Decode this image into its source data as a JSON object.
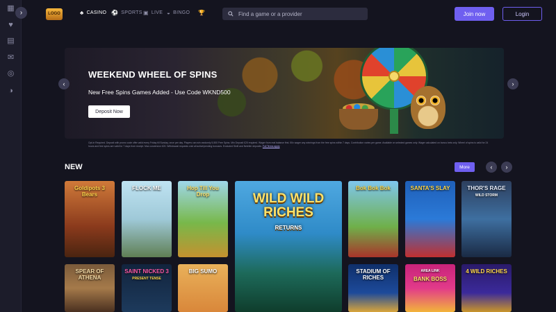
{
  "sidebar": {
    "items": [
      {
        "icon": "grid-icon",
        "glyph": "▦"
      },
      {
        "icon": "heart-icon",
        "glyph": "♥"
      },
      {
        "icon": "document-icon",
        "glyph": "▤"
      },
      {
        "icon": "gift-icon",
        "glyph": "✉"
      },
      {
        "icon": "chip-icon",
        "glyph": "◎"
      },
      {
        "icon": "chat-icon",
        "glyph": "◑"
      }
    ],
    "expand_glyph": "›"
  },
  "header": {
    "logo_text": "LOGO",
    "nav": [
      {
        "label": "CASINO",
        "glyph": "♣",
        "icon": "club-icon",
        "active": true
      },
      {
        "label": "SPORTS",
        "glyph": "⚽",
        "icon": "ball-icon",
        "active": false
      },
      {
        "label": "LIVE",
        "glyph": "▣",
        "icon": "live-icon",
        "active": false
      },
      {
        "label": "BINGO",
        "glyph": "◒",
        "icon": "bingo-icon",
        "active": false
      },
      {
        "label": "",
        "glyph": "🏆",
        "icon": "trophy-icon",
        "active": false
      }
    ],
    "search": {
      "placeholder": "Find a game or a provider",
      "value": ""
    },
    "join_label": "Join now",
    "login_label": "Login",
    "accent_color": "#6f5ff0"
  },
  "banner": {
    "title": "WEEKEND WHEEL OF SPINS",
    "subtitle": "New Free Spins Games Added - Use Code WKND500",
    "cta_label": "Deposit Now",
    "prev_glyph": "‹",
    "next_glyph": "›"
  },
  "terms": {
    "text": "Opt-in Required. Deposit with promo code offer valid every Friday till Sunday, once per day. Players can win randomly 5-500 Free Spins. Min Deposit £20 required. Wager from real balance first. 50x wager any winnings from the free spins within 7 days. Contribution varies per game. Available on selected games only. Wager calculated on bonus bets only. Wheel of spins is valid for 24 hours and free spins are valid for 7 days from receipt. Max conversion £20. Withdrawal requests void all active/pending bonuses. Excluded Skrill and Neteller deposits.",
    "link_label": "Full Terms apply"
  },
  "new_section": {
    "title": "NEW",
    "more_label": "More",
    "prev_glyph": "‹",
    "next_glyph": "›",
    "games": [
      {
        "name": "Goldipots 3 Bears",
        "sub": ""
      },
      {
        "name": "FLOCK ME",
        "sub": ""
      },
      {
        "name": "Hop Till You Drop",
        "sub": ""
      },
      {
        "name": "WILD WILD RICHES",
        "sub": "RETURNS"
      },
      {
        "name": "Bok Bok Bok",
        "sub": ""
      },
      {
        "name": "SANTA'S SLAY",
        "sub": ""
      },
      {
        "name": "THOR'S RAGE",
        "sub": "WILD STORM"
      },
      {
        "name": "SPEAR OF ATHENA",
        "sub": ""
      },
      {
        "name": "SAINT NICKED 3",
        "sub": "PRESENT TENSE"
      },
      {
        "name": "BIG SUMO",
        "sub": ""
      },
      {
        "name": "STADIUM OF RICHES",
        "sub": ""
      },
      {
        "name": "BANK BOSS",
        "sub": "AREA LINK"
      },
      {
        "name": "4 WILD RICHES",
        "sub": ""
      }
    ]
  }
}
